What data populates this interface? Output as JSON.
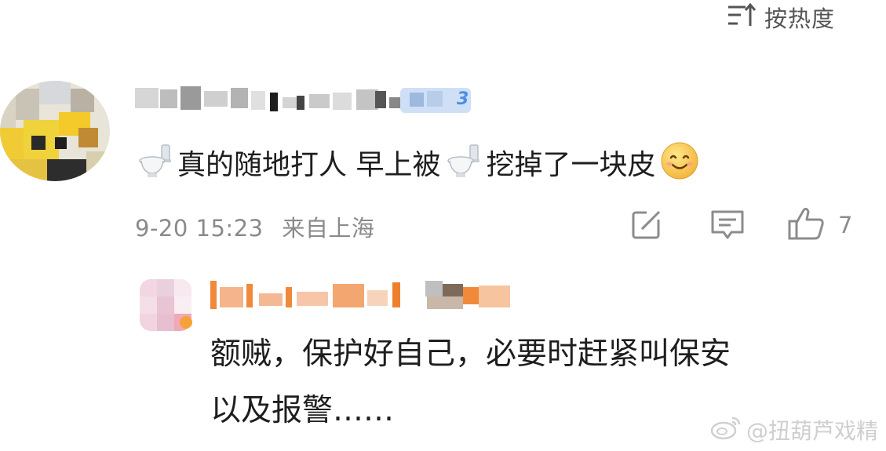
{
  "sort": {
    "label": "按热度",
    "icon": "sort-lines-icon"
  },
  "comment": {
    "avatar_icon": "pixelated-avatar",
    "badge_text": "3",
    "text_part1": "真的随地打人 早上被",
    "text_part2": "挖掉了一块皮",
    "emoji_icon": "toilet-emoji",
    "smile_icon": "smile-emoji",
    "timestamp": "9-20 15:23",
    "location": "来自上海",
    "like_count": "7"
  },
  "reply": {
    "avatar_icon": "pixelated-avatar",
    "line1": "额贼，保护好自己，必要时赶紧叫保安",
    "line2": "以及报警……"
  },
  "watermark": {
    "text": "@扭葫芦戏精",
    "icon": "weibo-logo-icon"
  },
  "colors": {
    "meta_gray": "#8a8a8a",
    "badge_blue": "#4a90e2",
    "reply_name_orange": "#f08a3a"
  }
}
